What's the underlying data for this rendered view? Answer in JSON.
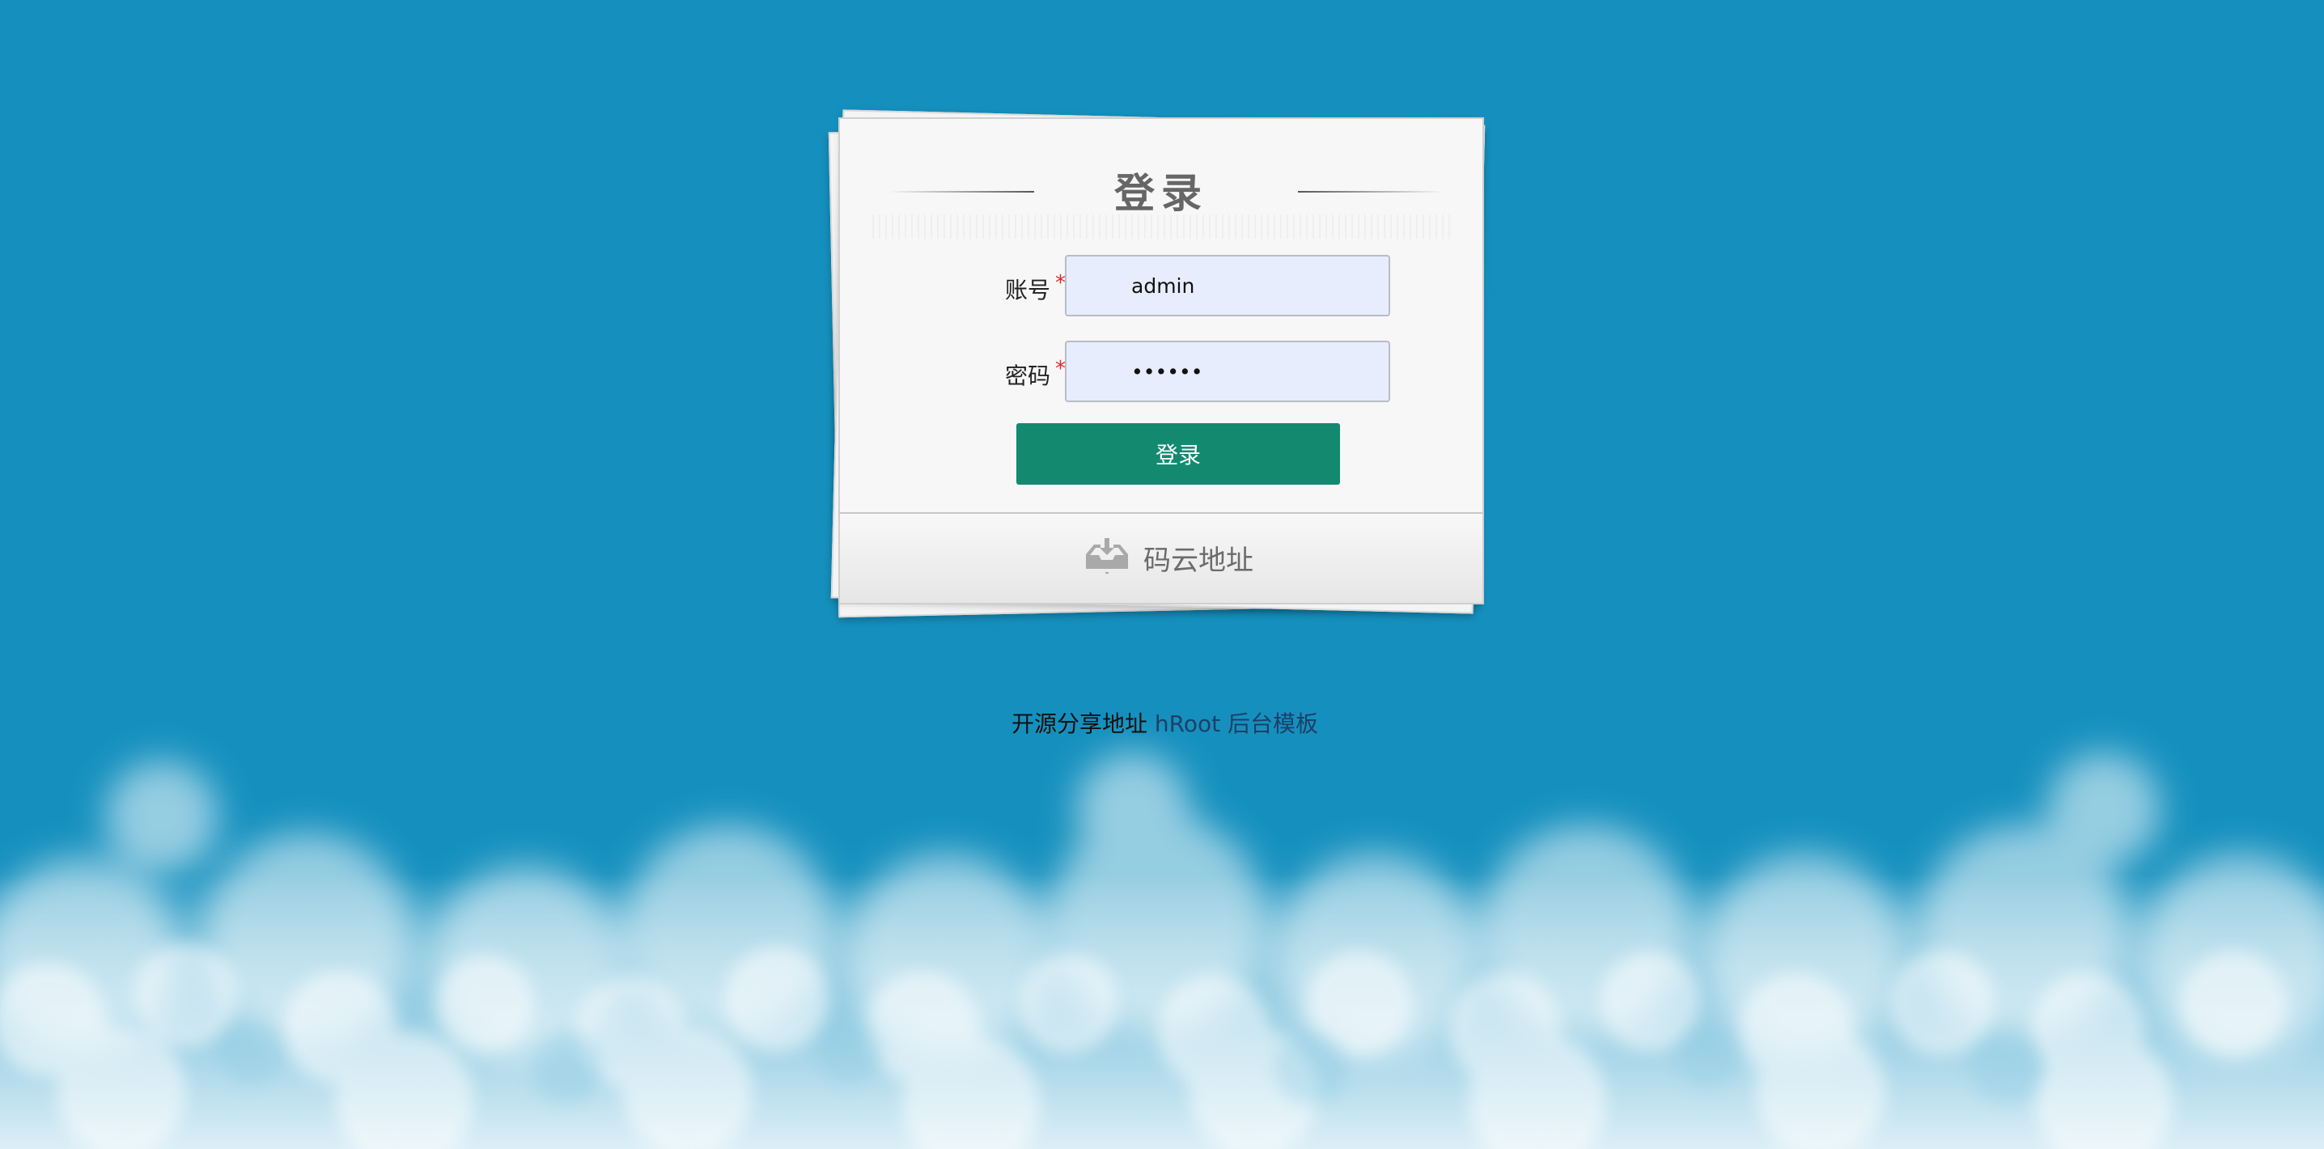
{
  "login": {
    "title": "登录",
    "account_label": "账号",
    "account_required": "*",
    "account_value": "admin",
    "password_label": "密码",
    "password_required": "*",
    "password_value": "••••••",
    "submit_label": "登录"
  },
  "footer": {
    "label": "码云地址",
    "icon": "inbox-download-icon"
  },
  "share": {
    "prefix": "开源分享地址",
    "link_text": "hRoot 后台模板"
  },
  "colors": {
    "background": "#1590be",
    "button": "#138a70",
    "input_bg": "#e7edfc",
    "required": "#e12b2b"
  }
}
